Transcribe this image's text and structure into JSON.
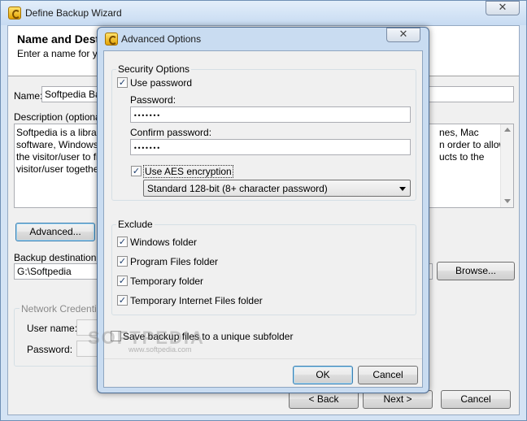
{
  "wizard": {
    "title": "Define Backup Wizard",
    "header_title": "Name and Dest",
    "header_subtitle": "Enter a name for you",
    "name_label": "Name:",
    "name_value": "Softpedia Bac",
    "description_label": "Description (optional):",
    "description_left": "Softpedia is a library o\nsoftware, Windows d\nthe visitor/user to find\nvisitor/user together v",
    "description_right": "nes, Mac\nn order to allow\nucts to the",
    "advanced_button": "Advanced...",
    "backup_destination_label": "Backup destination:",
    "backup_destination_value": "G:\\Softpedia",
    "browse_button": "Browse...",
    "network_credentials_label": "Network Credentials",
    "user_name_label": "User name:",
    "password_label": "Password:",
    "back_button": "< Back",
    "next_button": "Next >",
    "cancel_button": "Cancel",
    "close_glyph": "✕"
  },
  "dialog": {
    "title": "Advanced Options",
    "close_glyph": "✕",
    "security_group": "Security Options",
    "use_password": {
      "label": "Use password",
      "checked": true
    },
    "password_label": "Password:",
    "password_value": "•••••••",
    "confirm_label": "Confirm password:",
    "confirm_value": "•••••••",
    "use_aes": {
      "label": "Use AES encryption",
      "checked": true
    },
    "encryption_selected": "Standard 128-bit (8+ character password)",
    "exclude_group": "Exclude",
    "exclude_items": [
      {
        "label": "Windows folder",
        "checked": true
      },
      {
        "label": "Program Files folder",
        "checked": true
      },
      {
        "label": "Temporary folder",
        "checked": true
      },
      {
        "label": "Temporary Internet Files folder",
        "checked": true
      }
    ],
    "unique_subfolder": {
      "label": "Save backup files to a unique subfolder",
      "checked": false
    },
    "ok_button": "OK",
    "cancel_button": "Cancel",
    "check_glyph": "✓"
  },
  "watermark": {
    "text": "SOFTPEDIA",
    "subtext": "www.softpedia.com"
  },
  "colors": {
    "titlebar": "#c7dbf2",
    "dialog_frame": "#c9dcf1",
    "client": "#f0f0f0",
    "focus": "#3c7fb1"
  }
}
